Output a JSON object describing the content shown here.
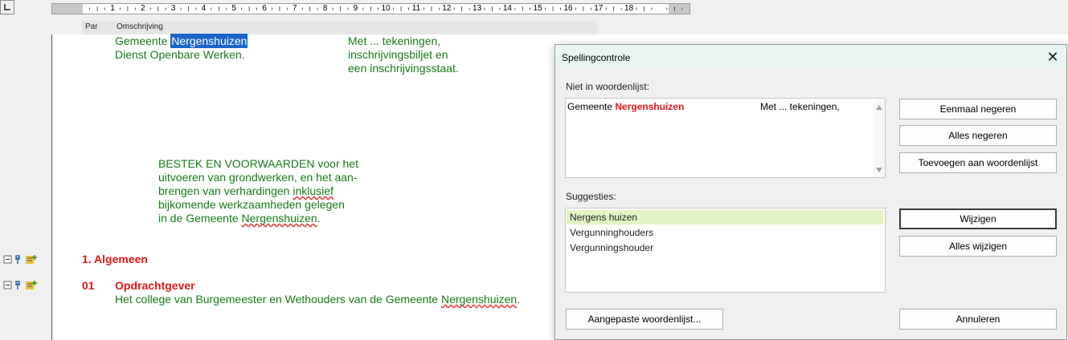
{
  "ruler": {
    "numbers": [
      "1",
      "2",
      "3",
      "4",
      "5",
      "6",
      "7",
      "8",
      "9",
      "10",
      "11",
      "12",
      "13",
      "14",
      "15",
      "16",
      "17",
      "18"
    ]
  },
  "column_header": {
    "par": "Par",
    "omschrijving": "Omschrijving"
  },
  "document": {
    "line1_a": "Gemeente ",
    "line1_sel": "Nergenshuizen",
    "line2": "Dienst Openbare Werken.",
    "col2": [
      "Met ... tekeningen,",
      "inschrijvingsbiljet en",
      "een inschrijvingsstaat."
    ],
    "bestek": {
      "l1": "BESTEK EN VOORWAARDEN voor het",
      "l2": "uitvoeren van grondwerken, en het aan-",
      "l3a": "brengen van verhardingen ",
      "l3b": "inklusief",
      "l4": "bijkomende werkzaamheden gelegen",
      "l5a": "in de Gemeente ",
      "l5b": "Nergenshuizen",
      "l5c": "."
    },
    "section1": "1. Algemeen",
    "par01_num": "01",
    "par01_title": "Opdrachtgever",
    "par01_text_a": "Het college van Burgemeester en Wethouders van de Gemeente ",
    "par01_text_b": "Nergenshuizen",
    "par01_text_c": "."
  },
  "dialog": {
    "title": "Spellingcontrole",
    "close": "✕",
    "not_in_dict_label": "Niet in woordenlijst:",
    "context_before": "Gemeente ",
    "context_word": "Nergenshuizen",
    "context_after": "Met ... tekeningen,",
    "suggestions_label": "Suggesties:",
    "suggestions": [
      "Nergens huizen",
      "Vergunninghouders",
      "Vergunningshouder"
    ],
    "buttons": {
      "ignore_once": "Eenmaal negeren",
      "ignore_all": "Alles negeren",
      "add": "Toevoegen aan woordenlijst",
      "change": "Wijzigen",
      "change_all": "Alles wijzigen",
      "custom_dict": "Aangepaste woordenlijst...",
      "cancel": "Annuleren"
    }
  },
  "colors": {
    "doc_text": "#1a7a1a",
    "heading": "#e01818",
    "selection": "#1c64c8",
    "selected_suggestion": "#e3f5c5"
  }
}
